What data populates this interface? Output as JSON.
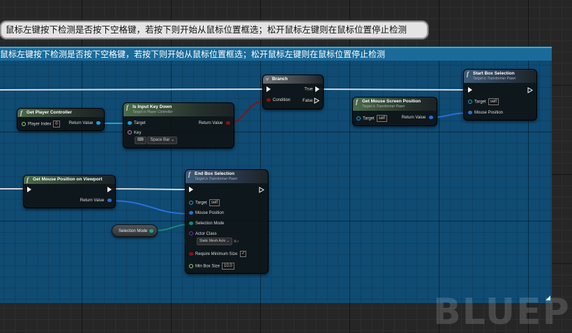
{
  "comment": {
    "bubble_text": "鼠标左键按下检测是否按下空格键，若按下则开始从鼠标位置框选；松开鼠标左键则在鼠标位置停止检测",
    "title_text": "鼠标左键按下检测是否按下空格键，若按下则开始从鼠标位置框选；松开鼠标左键则在鼠标位置停止检测",
    "color": "#1a6b9a"
  },
  "watermark": "BLUEPR",
  "resize_glyph": "◢",
  "nodes": {
    "get_player_controller": {
      "title": "Get Player Controller",
      "player_index_label": "Player Index",
      "player_index_value": "0",
      "return_label": "Return Value"
    },
    "is_input_key_down": {
      "title": "Is Input Key Down",
      "subtitle": "Target is Player Controller",
      "target_label": "Target",
      "return_label": "Return Value",
      "key_label": "Key",
      "key_icon": "keyboard-icon",
      "key_value": "Space Bar ⌄"
    },
    "branch": {
      "title": "Branch",
      "true_label": "True",
      "condition_label": "Condition",
      "false_label": "False"
    },
    "get_mouse_screen_position": {
      "title": "Get Mouse Screen Position",
      "subtitle": "Target is Transformer Pawn",
      "target_label": "Target",
      "target_value": "self",
      "return_label": "Return Value"
    },
    "start_box_selection": {
      "title": "Start Box Selection",
      "subtitle": "Target is Transformer Pawn",
      "target_label": "Target",
      "target_value": "self",
      "mouse_position_label": "Mouse Position"
    },
    "get_mouse_position_on_viewport": {
      "title": "Get Mouse Position on Viewport",
      "return_label": "Return Value"
    },
    "end_box_selection": {
      "title": "End Box Selection",
      "subtitle": "Target is Transformer Pawn",
      "target_label": "Target",
      "target_value": "self",
      "mouse_position_label": "Mouse Position",
      "selection_mode_label": "Selection Mode",
      "actor_class_label": "Actor Class",
      "actor_class_value": "Static Mesh Acto ⌄",
      "require_minimum_size_label": "Require Minimum Size",
      "require_minimum_size_value": "✓",
      "min_box_size_label": "Min Box Size",
      "min_box_size_value": "10.0"
    },
    "selection_mode_var": {
      "label": "Selection Mode"
    }
  },
  "pin_colors": {
    "exec": "#ffffff",
    "object": "#1fa0e0",
    "bool": "#8c1010",
    "struct": "#2a6fd6",
    "enum": "#138a76",
    "class": "#6a2fb0",
    "float": "#8ae06a"
  }
}
